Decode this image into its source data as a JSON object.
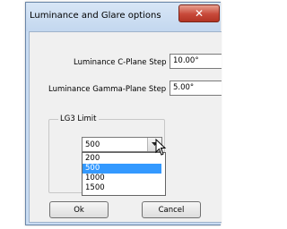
{
  "window": {
    "title": "Luminance and Glare options",
    "close_icon": "close-icon"
  },
  "form": {
    "c_plane_label": "Luminance C-Plane Step",
    "c_plane_value": "10.00°",
    "gamma_label": "Luminance Gamma-Plane Step",
    "gamma_value": "5.00°"
  },
  "lg3": {
    "group_label": "LG3 Limit",
    "selected": "500",
    "options": [
      "200",
      "500",
      "1000",
      "1500"
    ],
    "highlighted_option": "500"
  },
  "buttons": {
    "ok": "Ok",
    "cancel": "Cancel"
  },
  "colors": {
    "selection": "#3399ff",
    "titlebar": "#c9dcf2",
    "close_button": "#c7493a",
    "dialog_background": "#f0f0f0"
  }
}
